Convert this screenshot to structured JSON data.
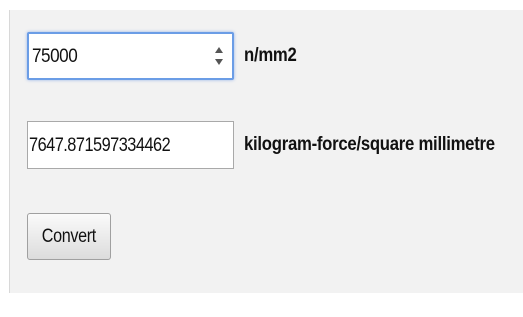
{
  "converter": {
    "input_value": "75000",
    "input_unit": "n/mm2",
    "output_value": "7647.871597334462",
    "output_unit": "kilogram-force/square millimetre",
    "convert_label": "Convert"
  }
}
